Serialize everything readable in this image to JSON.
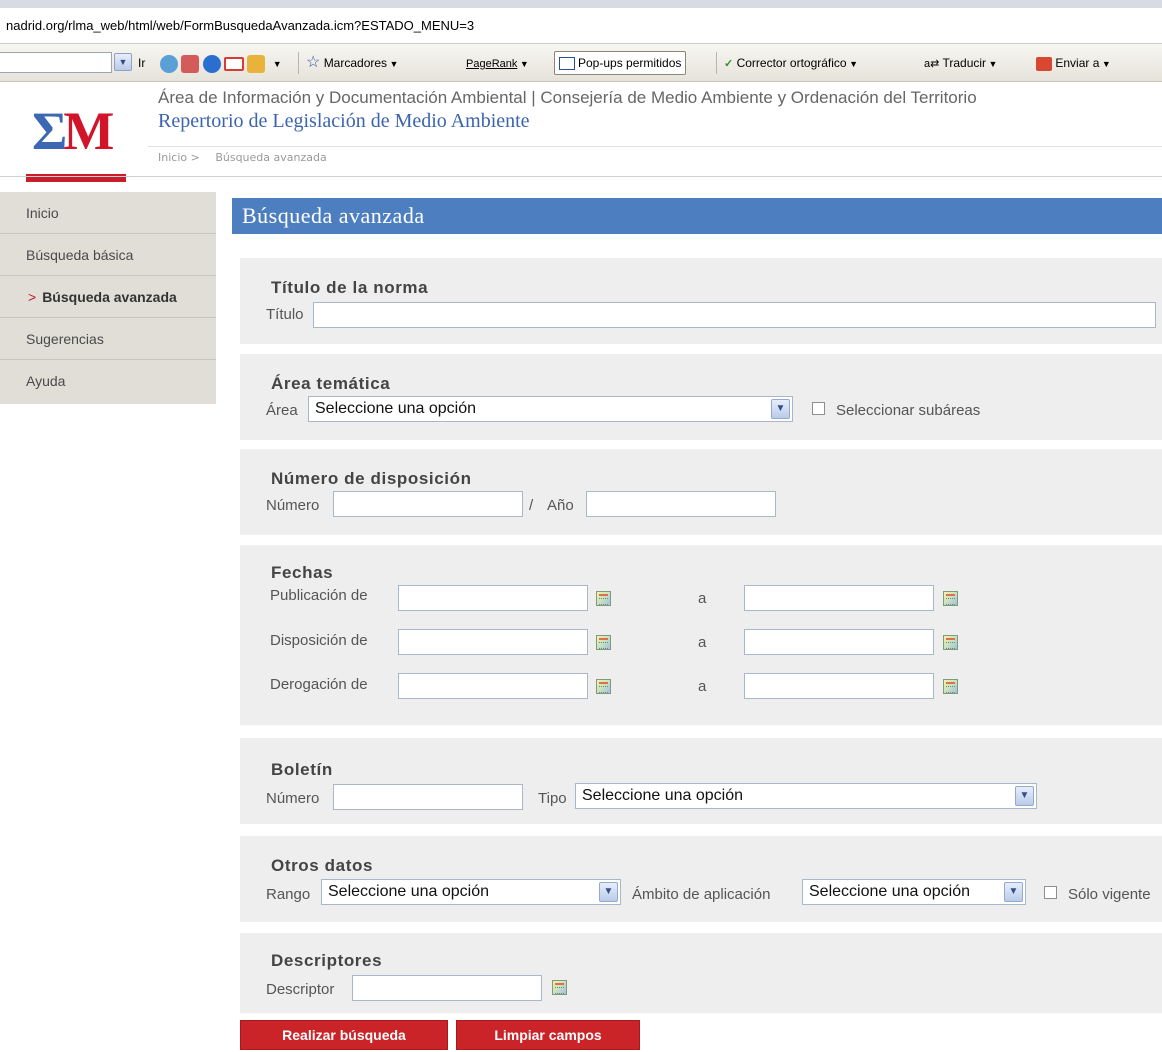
{
  "browser": {
    "url": "nadrid.org/rlma_web/html/web/FormBusquedaAvanzada.icm?ESTADO_MENU=3",
    "toolbar": {
      "go": "Ir",
      "bookmarks": "Marcadores",
      "pagerank": "PageRank",
      "popups": "Pop-ups permitidos",
      "spellcheck": "Corrector ortográfico",
      "translate": "Traducir",
      "send": "Enviar a"
    }
  },
  "header": {
    "org": "Área de Información y Documentación Ambiental | Consejería de Medio Ambiente y Ordenación del Territorio",
    "site_title": "Repertorio de Legislación de Medio Ambiente",
    "breadcrumb": [
      "Inicio >",
      "Búsqueda avanzada"
    ],
    "logo_text": "EM"
  },
  "sidebar": {
    "items": [
      {
        "label": "Inicio"
      },
      {
        "label": "Búsqueda básica"
      },
      {
        "label": "Búsqueda avanzada",
        "marker": ">"
      },
      {
        "label": "Sugerencias"
      },
      {
        "label": "Ayuda"
      }
    ]
  },
  "page_title": "Búsqueda avanzada",
  "sections": {
    "titulo": {
      "heading": "Título de la norma",
      "label": "Título"
    },
    "area": {
      "heading": "Área temática",
      "label": "Área",
      "select": "Seleccione una opción",
      "checkbox": "Seleccionar subáreas"
    },
    "numero": {
      "heading": "Número de disposición",
      "label": "Número",
      "slash": "/",
      "year_label": "Año"
    },
    "fechas": {
      "heading": "Fechas",
      "rows": [
        {
          "label": "Publicación de",
          "to": "a"
        },
        {
          "label": "Disposición de",
          "to": "a"
        },
        {
          "label": "Derogación de",
          "to": "a"
        }
      ]
    },
    "boletin": {
      "heading": "Boletín",
      "label": "Número",
      "tipo_label": "Tipo",
      "select": "Seleccione una opción"
    },
    "otros": {
      "heading": "Otros datos",
      "rango_label": "Rango",
      "rango_select": "Seleccione una opción",
      "ambito_label": "Ámbito de aplicación",
      "ambito_select": "Seleccione una opción",
      "checkbox": "Sólo vigente"
    },
    "descriptores": {
      "heading": "Descriptores",
      "label": "Descriptor"
    }
  },
  "buttons": {
    "search": "Realizar búsqueda",
    "clear": "Limpiar campos"
  },
  "colors": {
    "title_bar": "#4d7fc0",
    "button_red": "#cb2428",
    "section_bg": "#eeeeee",
    "sidebar_bg": "#e0ded6"
  }
}
